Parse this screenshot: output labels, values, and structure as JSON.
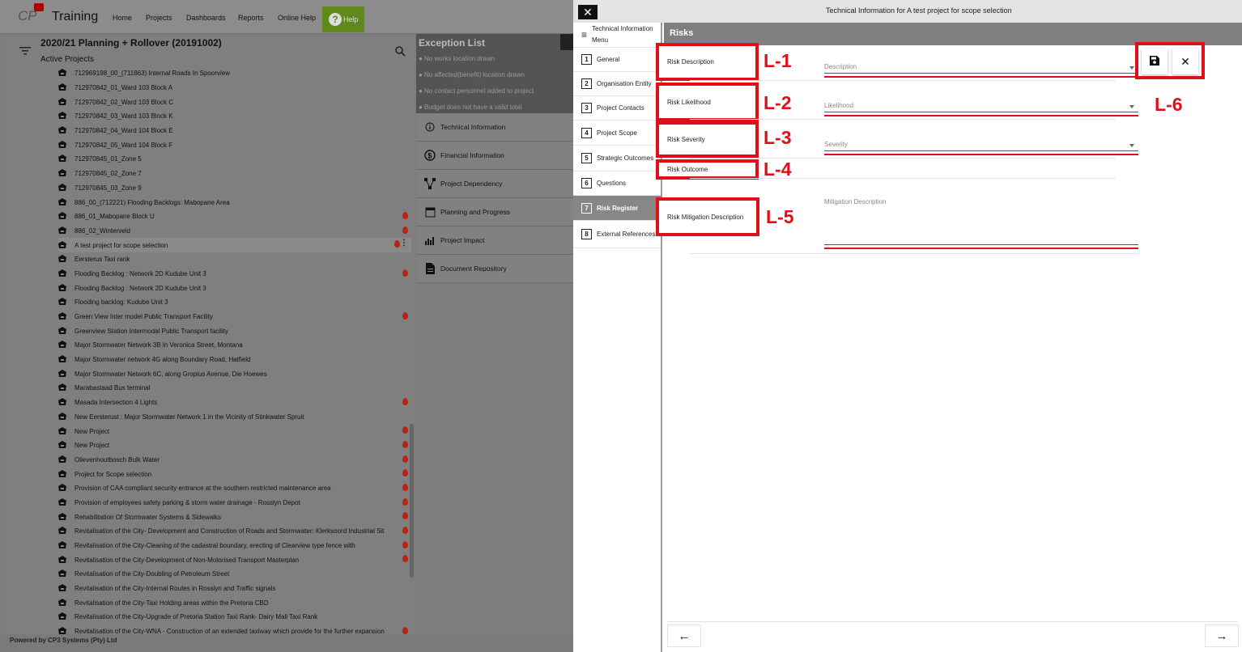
{
  "app": {
    "title": "Training",
    "nav": [
      "Home",
      "Projects",
      "Dashboards",
      "Reports",
      "Online Help"
    ],
    "help_label": "Help",
    "help_glyph": "?",
    "footer": "Powered by CP3 Systems (Pty) Ltd"
  },
  "projects": {
    "title": "2020/21 Planning + Rollover (20191002)",
    "subtitle": "Active Projects",
    "rows": [
      {
        "name": "712969198_00_(711863) Internal Roads In Spoorview",
        "flag": false
      },
      {
        "name": "712970842_01_Ward 103 Block A",
        "flag": false
      },
      {
        "name": "712970842_02_Ward 103 Block C",
        "flag": false
      },
      {
        "name": "712970842_03_Ward 103 Block K",
        "flag": false
      },
      {
        "name": "712970842_04_Ward 104 Block E",
        "flag": false
      },
      {
        "name": "712970842_05_Ward 104 Block F",
        "flag": false
      },
      {
        "name": "712970845_01_Zone 5",
        "flag": false
      },
      {
        "name": "712970845_02_Zone 7",
        "flag": false
      },
      {
        "name": "712970845_03_Zone 9",
        "flag": false
      },
      {
        "name": "886_00_(712221) Flooding Backlogs: Mabopane Area",
        "flag": false
      },
      {
        "name": "886_01_Mabopane Block U",
        "flag": true
      },
      {
        "name": "886_02_Winterveld",
        "flag": true
      },
      {
        "name": "A test project for scope selection",
        "flag": true,
        "selected": true
      },
      {
        "name": "Eersterus Taxi rank",
        "flag": false
      },
      {
        "name": "Flooding Backlog : Network 2D Kudube Unit 3",
        "flag": true
      },
      {
        "name": "Flooding Backlog : Network 2D Kudube Unit 3",
        "flag": false
      },
      {
        "name": "Flooding backlog: Kudube Unit 3",
        "flag": false
      },
      {
        "name": "Green View Inter model Public Transport Facility",
        "flag": true
      },
      {
        "name": "Greenview Station Intermodal Public Transport facility",
        "flag": false
      },
      {
        "name": "Major Stormwater Network 3B in Veronica Street, Montana",
        "flag": false
      },
      {
        "name": "Major Stormwater network 4G along Boundary Road, Hatfield",
        "flag": false
      },
      {
        "name": "Major Stormwater Network 6C, along Gropius Avenue, Die Hoewes",
        "flag": false
      },
      {
        "name": "Marabastaad Bus terminal",
        "flag": false
      },
      {
        "name": "Masada Intersection 4 Lights",
        "flag": true
      },
      {
        "name": "New Eersterust : Major Stormwater Network 1 in the Vicinity of Stinkwater Spruit",
        "flag": false
      },
      {
        "name": "New Project",
        "flag": true
      },
      {
        "name": "New Project",
        "flag": true
      },
      {
        "name": "Olievenhoutbosch Bulk Water",
        "flag": true
      },
      {
        "name": "Project for Scope selection",
        "flag": true
      },
      {
        "name": "Provision of CAA compliant security entrance at the southern restricted maintenance area",
        "flag": true
      },
      {
        "name": "Provision of employees safety parking & storm water drainage - Rosslyn Depot",
        "flag": true
      },
      {
        "name": "Rehabilitation Of Stormwater Systems & Sidewalks",
        "flag": true
      },
      {
        "name": "Revitalisation of the City- Development and Construction of Roads and Stormwater: Klerksoord Industrial Sit",
        "flag": true
      },
      {
        "name": "Revitalisation of the City-Cleaning of the cadastral boundary, erecting of Clearview type fence with",
        "flag": true
      },
      {
        "name": "Revitalisation of the City-Development of Non-Motorised Transport Masterplan",
        "flag": true
      },
      {
        "name": "Revitalisation of the City-Doubling of Petroleum Street",
        "flag": false
      },
      {
        "name": "Revitalisation of the City-Internal Routes in Rosslyn and Traffic signals",
        "flag": false
      },
      {
        "name": "Revitalisation of the City-Taxi Holding areas within the Pretoria CBD",
        "flag": false
      },
      {
        "name": "Revitalisation of the City-Upgrade of Pretoria Station Taxi Rank- Dairy Mall Taxi Rank",
        "flag": false
      },
      {
        "name": "Revitalisation of the City-WNA - Construction of an extended taxiway which provide for the further expansion",
        "flag": true
      }
    ]
  },
  "exceptions": {
    "title": "Exception List",
    "items": [
      "● No works location drawn",
      "● No affected(benefit) location drawn",
      "● No contact personnel added to project",
      "● Budget does not have a valid total"
    ]
  },
  "project_menu": [
    {
      "label": "Technical Information",
      "icon": "info-icon"
    },
    {
      "label": "Financial Information",
      "icon": "dollar-icon"
    },
    {
      "label": "Project Dependency",
      "icon": "dependency-icon"
    },
    {
      "label": "Planning and Progress",
      "icon": "calendar-icon"
    },
    {
      "label": "Project Impact",
      "icon": "chart-icon"
    },
    {
      "label": "Document Repository",
      "icon": "document-icon"
    }
  ],
  "dialog": {
    "title": "Technical Information for A test project for scope selection",
    "menu_header": "Technical Information Menu",
    "menu": [
      {
        "num": "1",
        "label": "General"
      },
      {
        "num": "2",
        "label": "Organisation Entity"
      },
      {
        "num": "3",
        "label": "Project Contacts"
      },
      {
        "num": "4",
        "label": "Project Scope"
      },
      {
        "num": "5",
        "label": "Strategic Outcomes"
      },
      {
        "num": "6",
        "label": "Questions"
      },
      {
        "num": "7",
        "label": "Risk Register",
        "active": true
      },
      {
        "num": "8",
        "label": "External References"
      }
    ],
    "section_title": "Risks",
    "labels": {
      "description": "Risk Description",
      "likelihood": "Risk Likelihood",
      "severity": "Risk Severity",
      "outcome": "Risk Outcome",
      "mitigation": "Risk Mitigation Description"
    },
    "fields": {
      "description": "Description",
      "likelihood": "Likelihood",
      "severity": "Severity",
      "mitigation": "Mitigation Description"
    },
    "tags": [
      "L-1",
      "L-2",
      "L-3",
      "L-4",
      "L-5",
      "L-6"
    ],
    "save_icon": "save-icon",
    "close_icon": "close-icon",
    "back_arrow": "←",
    "next_arrow": "→"
  },
  "colors": {
    "annotation": "#e0101a",
    "help_green": "#5e8a1c",
    "header_grey": "#7f7f7f"
  }
}
